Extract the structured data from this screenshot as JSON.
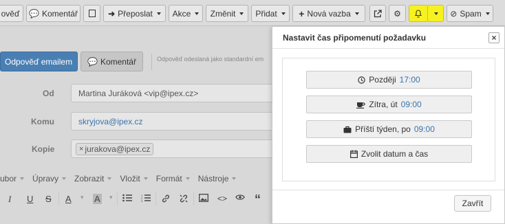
{
  "toolbar": {
    "reply": "ověď",
    "comment": "Komentář",
    "forward": "Přeposlat",
    "actions": "Akce",
    "change": "Změnit",
    "add": "Přidat",
    "new_link": "Nová vazba",
    "spam": "Spam"
  },
  "compose": {
    "reply_tab": "Odpověď emailem",
    "comment_tab": "Komentář",
    "note": "Odpověď odeslaná jako standardní em",
    "from_label": "Od",
    "from_value": "Martina Juráková <vip@ipex.cz>",
    "to_label": "Komu",
    "to_value": "skryjova@ipex.cz",
    "cc_label": "Kopie",
    "cc_chip": "jurakova@ipex.cz",
    "menu": [
      "ubor",
      "Úpravy",
      "Zobrazit",
      "Vložit",
      "Formát",
      "Nástroje"
    ]
  },
  "dialog": {
    "title": "Nastavit čas připomenutí požadavku",
    "close_x": "×",
    "options": [
      {
        "label": "Později",
        "time": "17:00",
        "icon": "clock-icon"
      },
      {
        "label": "Zítra, út",
        "time": "09:00",
        "icon": "coffee-icon"
      },
      {
        "label": "Příští týden, po",
        "time": "09:00",
        "icon": "briefcase-icon"
      },
      {
        "label": "Zvolit datum a čas",
        "time": "",
        "icon": "calendar-icon"
      }
    ],
    "close_button": "Zavřít"
  },
  "colors": {
    "accent": "#4a7fb3",
    "bell_highlight": "#f7f21f",
    "time_text": "#3a73ad"
  }
}
